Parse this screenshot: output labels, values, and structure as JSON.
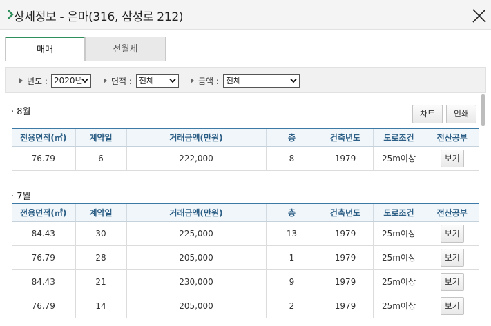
{
  "header": {
    "title": "상세정보 - 은마(316, 삼성로 212)"
  },
  "tabs": [
    {
      "label": "매매"
    },
    {
      "label": "전월세"
    }
  ],
  "filters": {
    "year_label": "년도 :",
    "year_value": "2020년",
    "area_label": "면적 :",
    "area_value": "전체",
    "price_label": "금액 :",
    "price_value": "전체"
  },
  "columns": [
    "전용면적(㎡)",
    "계약일",
    "거래금액(만원)",
    "층",
    "건축년도",
    "도로조건",
    "전산공부"
  ],
  "sections": [
    {
      "title": "· 8월",
      "rows": [
        {
          "area": "76.79",
          "day": "6",
          "price": "222,000",
          "floor": "8",
          "year": "1979",
          "road": "25m이상",
          "view": "보기"
        }
      ]
    },
    {
      "title": "· 7월",
      "rows": [
        {
          "area": "84.43",
          "day": "30",
          "price": "225,000",
          "floor": "13",
          "year": "1979",
          "road": "25m이상",
          "view": "보기"
        },
        {
          "area": "76.79",
          "day": "28",
          "price": "205,000",
          "floor": "1",
          "year": "1979",
          "road": "25m이상",
          "view": "보기"
        },
        {
          "area": "84.43",
          "day": "21",
          "price": "230,000",
          "floor": "9",
          "year": "1979",
          "road": "25m이상",
          "view": "보기"
        },
        {
          "area": "76.79",
          "day": "14",
          "price": "205,000",
          "floor": "2",
          "year": "1979",
          "road": "25m이상",
          "view": "보기"
        }
      ]
    }
  ],
  "actions": {
    "chart_label": "차트",
    "print_label": "인쇄"
  },
  "colors": {
    "accent_green": "#2f8f5b",
    "table_header_blue": "#3d7aa6"
  },
  "icons": {
    "header_marker": "chevron-right-icon",
    "close": "close-icon",
    "filter_marker": "triangle-right-icon",
    "dropdown": "chevron-down-icon"
  }
}
